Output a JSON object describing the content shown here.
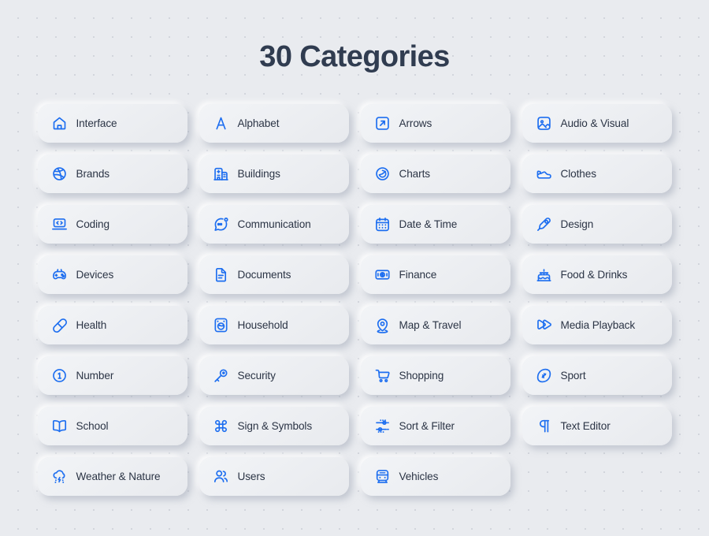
{
  "header": {
    "title": "30 Categories"
  },
  "theme": {
    "background": "#e9ebef",
    "dot_color": "#d2d5dc",
    "card_background": "#eef0f4",
    "accent": "#1d6ef0",
    "title_color": "#303c50",
    "label_color": "#2b3445"
  },
  "categories": [
    {
      "label": "Interface",
      "icon": "home-icon"
    },
    {
      "label": "Alphabet",
      "icon": "letter-a-icon"
    },
    {
      "label": "Arrows",
      "icon": "arrow-up-right-box-icon"
    },
    {
      "label": "Audio & Visual",
      "icon": "image-picture-icon"
    },
    {
      "label": "Brands",
      "icon": "dribbble-circle-icon"
    },
    {
      "label": "Buildings",
      "icon": "hospital-building-icon"
    },
    {
      "label": "Charts",
      "icon": "pie-chart-icon"
    },
    {
      "label": "Clothes",
      "icon": "shoe-icon"
    },
    {
      "label": "Coding",
      "icon": "laptop-code-icon"
    },
    {
      "label": "Communication",
      "icon": "chat-bubble-icon"
    },
    {
      "label": "Date & Time",
      "icon": "calendar-icon"
    },
    {
      "label": "Design",
      "icon": "pen-nib-icon"
    },
    {
      "label": "Devices",
      "icon": "gamepad-icon"
    },
    {
      "label": "Documents",
      "icon": "file-document-icon"
    },
    {
      "label": "Finance",
      "icon": "banknote-dollar-icon"
    },
    {
      "label": "Food & Drinks",
      "icon": "cake-icon"
    },
    {
      "label": "Health",
      "icon": "pill-capsule-icon"
    },
    {
      "label": "Household",
      "icon": "washing-machine-icon"
    },
    {
      "label": "Map & Travel",
      "icon": "location-pin-icon"
    },
    {
      "label": "Media Playback",
      "icon": "fast-forward-icon"
    },
    {
      "label": "Number",
      "icon": "circled-one-icon"
    },
    {
      "label": "Security",
      "icon": "key-icon"
    },
    {
      "label": "Shopping",
      "icon": "shopping-cart-icon"
    },
    {
      "label": "Sport",
      "icon": "football-icon"
    },
    {
      "label": "School",
      "icon": "open-book-icon"
    },
    {
      "label": "Sign & Symbols",
      "icon": "command-key-icon"
    },
    {
      "label": "Sort & Filter",
      "icon": "sliders-filter-icon"
    },
    {
      "label": "Text Editor",
      "icon": "pilcrow-icon"
    },
    {
      "label": "Weather & Nature",
      "icon": "storm-cloud-icon"
    },
    {
      "label": "Users",
      "icon": "users-group-icon"
    },
    {
      "label": "Vehicles",
      "icon": "tram-train-icon"
    }
  ]
}
